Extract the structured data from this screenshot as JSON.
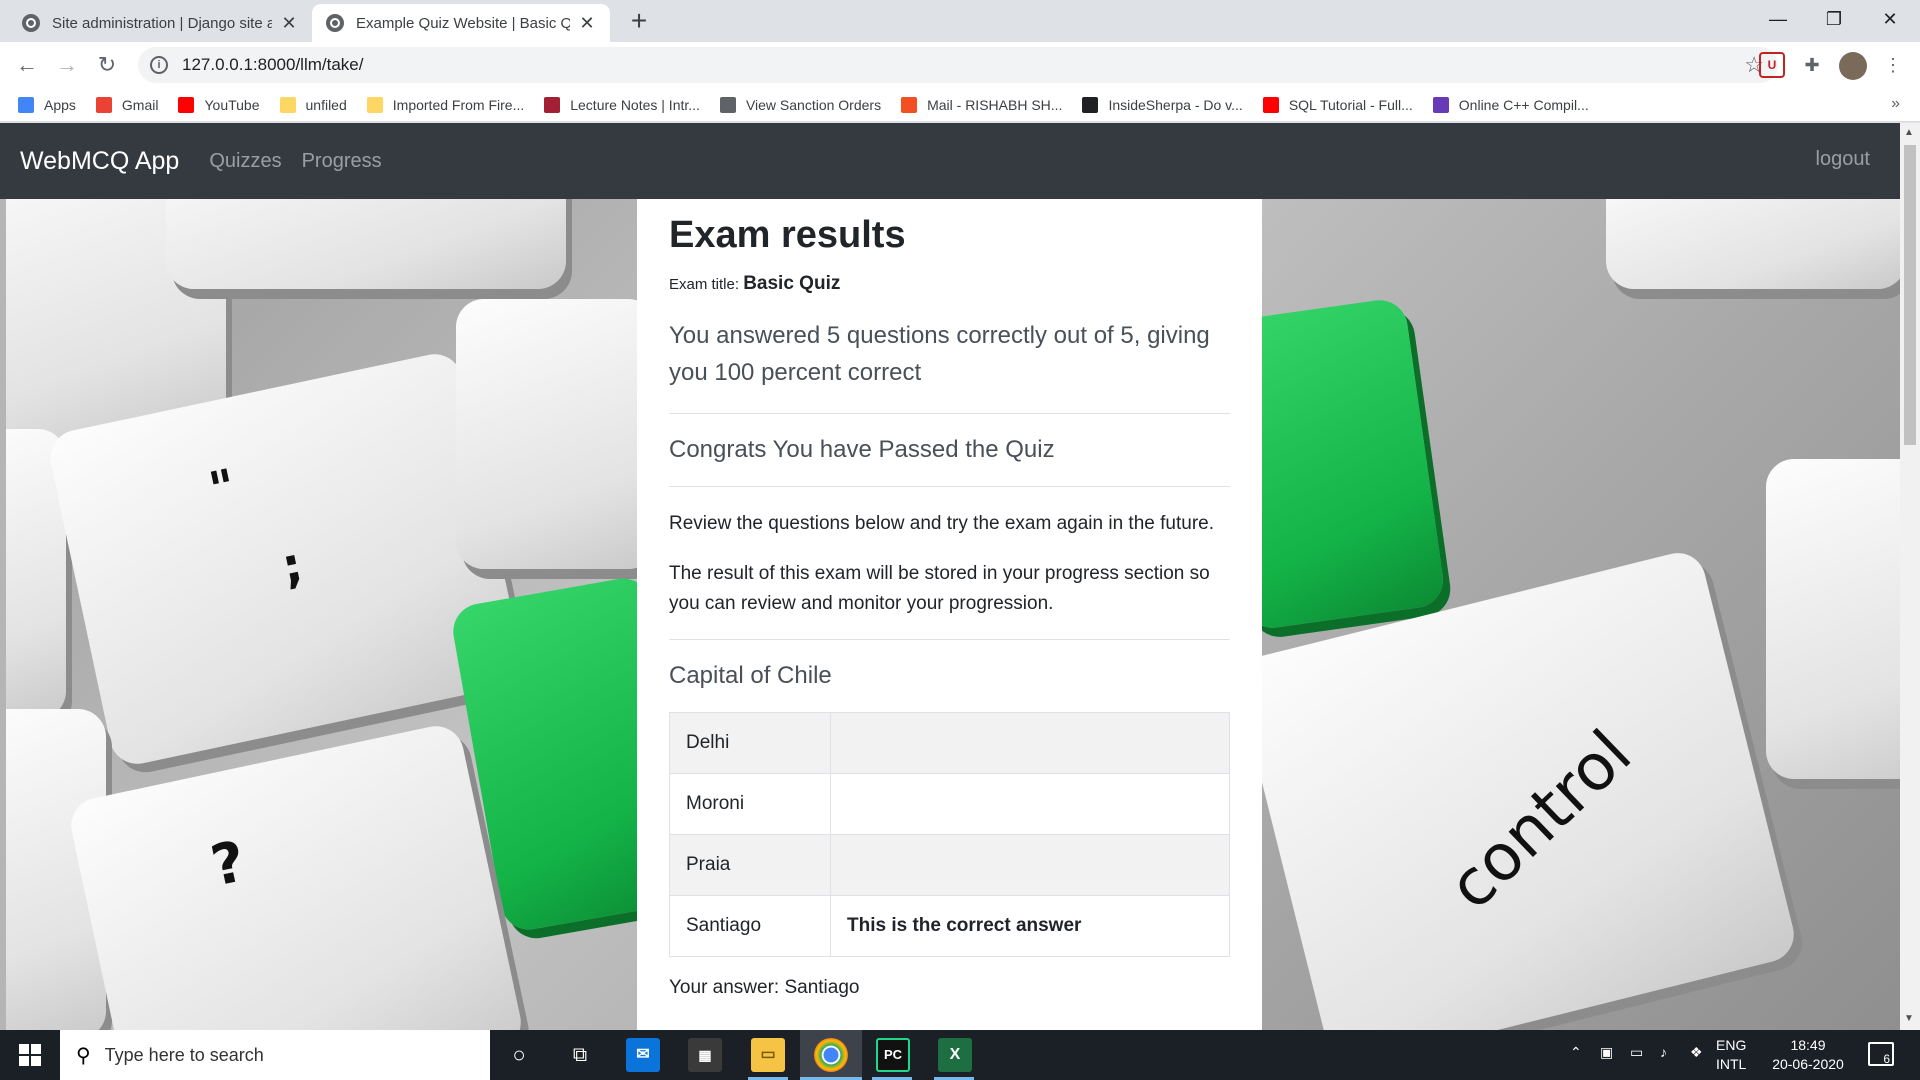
{
  "browser": {
    "tabs": [
      {
        "title": "Site administration | Django site admin"
      },
      {
        "title": "Example Quiz Website | Basic Quiz"
      }
    ],
    "new_tab_symbol": "+",
    "url": "127.0.0.1:8000/llm/take/",
    "window_controls": {
      "minimize": "—",
      "maximize": "❐",
      "close": "✕"
    },
    "bookmarks": [
      {
        "label": "Apps",
        "icon": "apps-grid-icon",
        "color": "#4285f4"
      },
      {
        "label": "Gmail",
        "icon": "gmail-icon",
        "color": "#ea4335"
      },
      {
        "label": "YouTube",
        "icon": "youtube-icon",
        "color": "#ff0000"
      },
      {
        "label": "unfiled",
        "icon": "folder-icon",
        "color": "#fdd663"
      },
      {
        "label": "Imported From Fire...",
        "icon": "folder-icon",
        "color": "#fdd663"
      },
      {
        "label": "Lecture Notes | Intr...",
        "icon": "mit-icon",
        "color": "#a31f34"
      },
      {
        "label": "View Sanction Orders",
        "icon": "globe-icon",
        "color": "#5f6368"
      },
      {
        "label": "Mail - RISHABH SH...",
        "icon": "microsoft-icon",
        "color": "#f25022"
      },
      {
        "label": "InsideSherpa - Do v...",
        "icon": "mountain-icon",
        "color": "#202124"
      },
      {
        "label": "SQL Tutorial - Full...",
        "icon": "youtube-icon",
        "color": "#ff0000"
      },
      {
        "label": "Online C++ Compil...",
        "icon": "bolt-icon",
        "color": "#673ab7"
      }
    ],
    "bookmarks_more": "»"
  },
  "app": {
    "brand": "WebMCQ App",
    "nav": [
      "Quizzes",
      "Progress"
    ],
    "logout": "logout"
  },
  "results": {
    "heading": "Exam results",
    "exam_title_label": "Exam title:",
    "exam_title": "Basic Quiz",
    "score_text": "You answered 5 questions correctly out of 5, giving you 100 percent correct",
    "pass_message": "Congrats You have Passed the Quiz",
    "review_text": "Review the questions below and try the exam again in the future.",
    "storage_text": "The result of this exam will be stored in your progress section so you can review and monitor your progression.",
    "question": "Capital of Chile",
    "options": [
      {
        "answer": "Delhi",
        "note": ""
      },
      {
        "answer": "Moroni",
        "note": ""
      },
      {
        "answer": "Praia",
        "note": ""
      },
      {
        "answer": "Santiago",
        "note": "This is the correct answer"
      }
    ],
    "your_answer": "Your answer: Santiago"
  },
  "background_keys": {
    "glyph_quote": "\"",
    "glyph_semicolon": ";",
    "glyph_question": "?",
    "glyph_control": "control",
    "accent_green": "#17b94a"
  },
  "taskbar": {
    "search_placeholder": "Type here to search",
    "language_top": "ENG",
    "language_bottom": "INTL",
    "time": "18:49",
    "date": "20-06-2020",
    "notification_count": "6"
  }
}
